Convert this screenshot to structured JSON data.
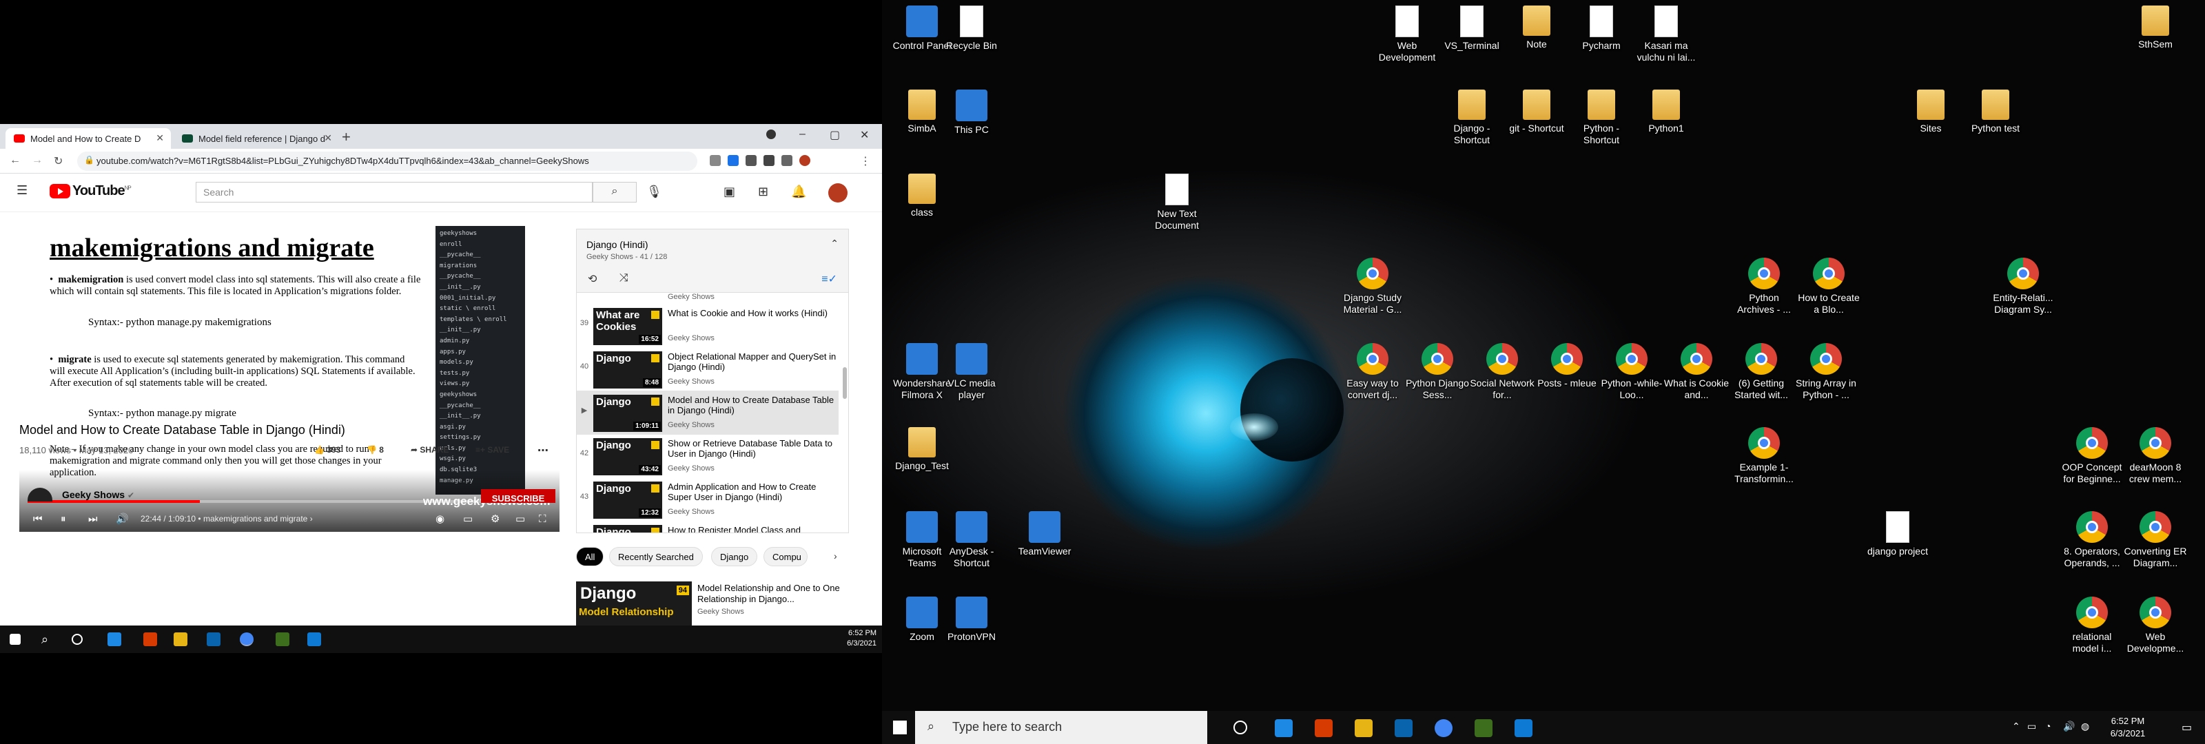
{
  "browser": {
    "tabs": [
      {
        "title": "Model and How to Create D",
        "active": true
      },
      {
        "title": "Model field reference | Django d",
        "active": false
      }
    ],
    "url": "youtube.com/watch?v=M6T1RgtS8b4&list=PLbGui_ZYuhigchy8DTw4pX4duTTpvqlh6&index=43&ab_channel=GeekyShows",
    "window_controls": {
      "minimize": "–",
      "maximize": "▢",
      "close": "✕"
    }
  },
  "youtube": {
    "logo": "YouTube",
    "logo_badge": "NP",
    "search_placeholder": "Search"
  },
  "video": {
    "slide_title": "makemigrations and migrate",
    "bullet1_term": "makemigration",
    "bullet1_text": " is used convert model class into sql statements. This will also create a file which will contain sql statements. This file is located in Application’s migrations folder.",
    "syntax1": "Syntax:- python manage.py makemigrations",
    "bullet2_term": "migrate",
    "bullet2_text": " is used to execute sql statements generated by makemigration. This command will execute All Application’s (including built-in applications) SQL Statements if available. After execution of sql statements table will be created.",
    "syntax2": "Syntax:- python manage.py migrate",
    "note": "Note – If you make any change in your own model class you are required to run makemigration and migrate command only then you will get those changes in your application.",
    "tree": [
      "geekyshows",
      "enroll",
      "__pycache__",
      "migrations",
      "__pycache__",
      "__init__.py",
      "0001_initial.py",
      "static \\ enroll",
      "templates \\ enroll",
      "__init__.py",
      "admin.py",
      "apps.py",
      "models.py",
      "tests.py",
      "views.py",
      "geekyshows",
      "__pycache__",
      "__init__.py",
      "asgi.py",
      "settings.py",
      "urls.py",
      "wsgi.py",
      "db.sqlite3",
      "manage.py"
    ],
    "time": "22:44 / 1:09:10",
    "chapter": "makemigrations and migrate",
    "progress_fraction": 0.329,
    "watermark": "www.geekyshows.com",
    "title": "Model and How to Create Database Table in Django (Hindi)",
    "meta": "18,110 views • May 13, 2020",
    "likes": "393",
    "dislikes": "8",
    "share": "SHARE",
    "save": "SAVE",
    "channel": "Geeky Shows",
    "subscribe": "SUBSCRIBE"
  },
  "playlist": {
    "name": "Django (Hindi)",
    "sub": "Geeky Shows - 41 / 128",
    "top_partial": "Geeky Shows",
    "items": [
      {
        "num": "39",
        "title": "What is Cookie and How it works (Hindi)",
        "channel": "Geeky Shows",
        "duration": "16:52",
        "thumb": "What are Cookies"
      },
      {
        "num": "40",
        "title": "Object Relational Mapper and QuerySet in Django (Hindi)",
        "channel": "Geeky Shows",
        "duration": "8:48",
        "thumb": "Django"
      },
      {
        "num": "▶",
        "title": "Model and How to Create Database Table in Django (Hindi)",
        "channel": "Geeky Shows",
        "duration": "1:09:11",
        "thumb": "Django"
      },
      {
        "num": "42",
        "title": "Show or Retrieve Database Table Data to User in Django (Hindi)",
        "channel": "Geeky Shows",
        "duration": "43:42",
        "thumb": "Django"
      },
      {
        "num": "43",
        "title": "Admin Application and How to Create Super User in Django (Hindi)",
        "channel": "Geeky Shows",
        "duration": "12:32",
        "thumb": "Django"
      },
      {
        "num": "",
        "title": "How to Register Model Class and",
        "channel": "",
        "duration": "",
        "thumb": "Django"
      }
    ]
  },
  "chips": [
    "All",
    "Recently Searched",
    "Django",
    "Compu"
  ],
  "recommended": {
    "title": "Model Relationship and One to One Relationship in Django...",
    "channel": "Geeky Shows",
    "thumb_top": "Django",
    "thumb_bottom": "Model Relationship",
    "badge": "94"
  },
  "left_clock": {
    "time": "6:52 PM",
    "date": "6/3/2021"
  },
  "desktop_icons": [
    {
      "label": "Control Panel",
      "type": "blue"
    },
    {
      "label": "Recycle Bin",
      "type": "file"
    },
    {
      "label": "Web Development",
      "type": "file"
    },
    {
      "label": "VS_Terminal",
      "type": "file"
    },
    {
      "label": "Note",
      "type": "folder"
    },
    {
      "label": "Pycharm",
      "type": "file"
    },
    {
      "label": "Kasari ma vulchu ni lai...",
      "type": "file"
    },
    {
      "label": "SthSem",
      "type": "folder"
    },
    {
      "label": "SimbA",
      "type": "folder"
    },
    {
      "label": "This PC",
      "type": "blue"
    },
    {
      "label": "Django - Shortcut",
      "type": "folder"
    },
    {
      "label": "git - Shortcut",
      "type": "folder"
    },
    {
      "label": "Python - Shortcut",
      "type": "folder"
    },
    {
      "label": "Python1",
      "type": "folder"
    },
    {
      "label": "Sites",
      "type": "folder"
    },
    {
      "label": "Python test",
      "type": "folder"
    },
    {
      "label": "class",
      "type": "folder"
    },
    {
      "label": "New Text Document",
      "type": "file"
    },
    {
      "label": "Django Study Material - G...",
      "type": "chrome"
    },
    {
      "label": "Python Archives - ...",
      "type": "chrome"
    },
    {
      "label": "How to Create a Blo...",
      "type": "chrome"
    },
    {
      "label": "Entity-Relati... Diagram Sy...",
      "type": "chrome"
    },
    {
      "label": "Wondershare Filmora X",
      "type": "blue"
    },
    {
      "label": "VLC media player",
      "type": "blue"
    },
    {
      "label": "Easy way to convert dj...",
      "type": "chrome"
    },
    {
      "label": "Python Django Sess...",
      "type": "chrome"
    },
    {
      "label": "Social Network for...",
      "type": "chrome"
    },
    {
      "label": "Posts - mleue",
      "type": "chrome"
    },
    {
      "label": "Python -while- Loo...",
      "type": "chrome"
    },
    {
      "label": "What is Cookie and...",
      "type": "chrome"
    },
    {
      "label": "(6) Getting Started wit...",
      "type": "chrome"
    },
    {
      "label": "String Array in Python - ...",
      "type": "chrome"
    },
    {
      "label": "Django_Test",
      "type": "folder"
    },
    {
      "label": "Example 1- Transformin...",
      "type": "chrome"
    },
    {
      "label": "OOP Concept for Beginne...",
      "type": "chrome"
    },
    {
      "label": "dearMoon 8 crew mem...",
      "type": "chrome"
    },
    {
      "label": "Microsoft Teams",
      "type": "blue"
    },
    {
      "label": "AnyDesk - Shortcut",
      "type": "blue"
    },
    {
      "label": "TeamViewer",
      "type": "blue"
    },
    {
      "label": "django project",
      "type": "file"
    },
    {
      "label": "8. Operators, Operands, ...",
      "type": "chrome"
    },
    {
      "label": "Converting ER Diagram...",
      "type": "chrome"
    },
    {
      "label": "Zoom",
      "type": "blue"
    },
    {
      "label": "ProtonVPN",
      "type": "blue"
    },
    {
      "label": "relational model i...",
      "type": "chrome"
    },
    {
      "label": "Web Developme...",
      "type": "chrome"
    }
  ],
  "right_taskbar": {
    "search_placeholder": "Type here to search",
    "time": "6:52 PM",
    "date": "6/3/2021"
  }
}
